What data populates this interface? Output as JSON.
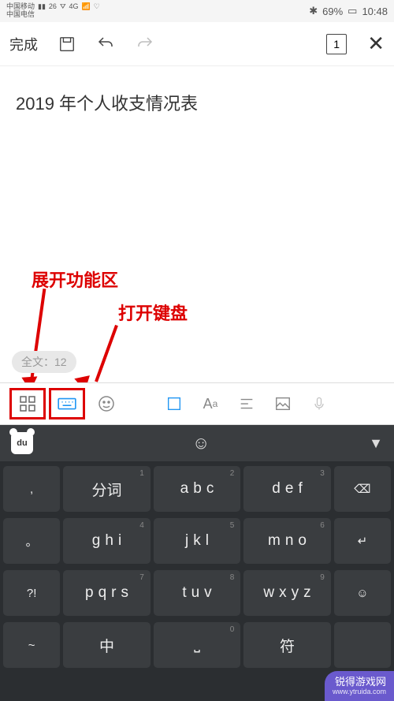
{
  "status": {
    "carrier1": "中国移动",
    "carrier2": "中国电信",
    "net_badge": "26",
    "net_4g": "4G",
    "bluetooth": "✱",
    "battery_pct": "69%",
    "time": "10:48"
  },
  "toolbar": {
    "done": "完成",
    "page_count": "1"
  },
  "content": {
    "title": "2019 年个人收支情况表"
  },
  "annotations": {
    "expand": "展开功能区",
    "open_kb": "打开键盘"
  },
  "chip": {
    "text": "全文：12"
  },
  "keyboard": {
    "row1": {
      "side": ",",
      "k1": {
        "num": "1",
        "label": "分词"
      },
      "k2": {
        "num": "2",
        "letters": [
          "a",
          "b",
          "c"
        ]
      },
      "k3": {
        "num": "3",
        "letters": [
          "d",
          "e",
          "f"
        ]
      },
      "back": "⌫"
    },
    "row2": {
      "side": "。",
      "k1": {
        "num": "4",
        "letters": [
          "g",
          "h",
          "i"
        ]
      },
      "k2": {
        "num": "5",
        "letters": [
          "j",
          "k",
          "l"
        ]
      },
      "k3": {
        "num": "6",
        "letters": [
          "m",
          "n",
          "o"
        ]
      },
      "enter": "↵"
    },
    "row3": {
      "side": "?!",
      "k1": {
        "num": "7",
        "letters": [
          "p",
          "q",
          "r",
          "s"
        ]
      },
      "k2": {
        "num": "8",
        "letters": [
          "t",
          "u",
          "v"
        ]
      },
      "k3": {
        "num": "9",
        "letters": [
          "w",
          "x",
          "y",
          "z"
        ]
      },
      "emoji": "☺"
    },
    "row4": {
      "side": "~",
      "k1": "中",
      "k3": "符",
      "num0": "0"
    }
  },
  "watermark": {
    "name": "锐得游戏网",
    "url": "www.ytruida.com"
  }
}
